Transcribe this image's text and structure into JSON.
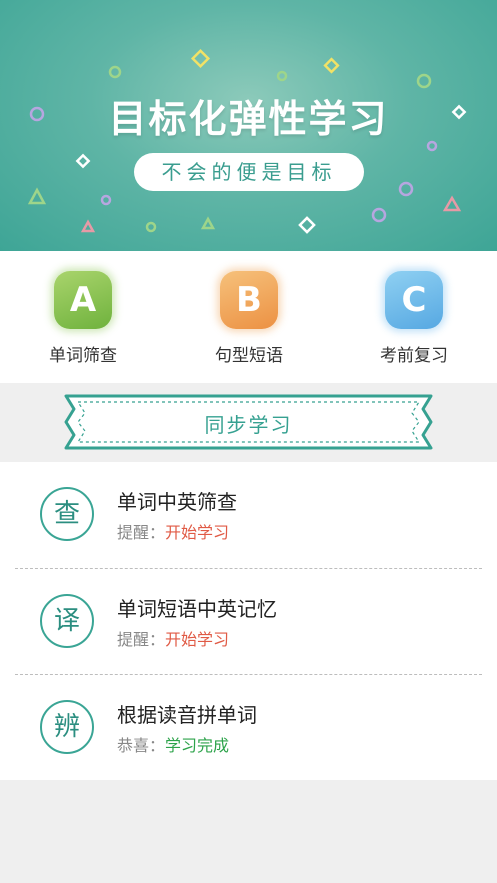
{
  "banner": {
    "title": "目标化弹性学习",
    "pill": "不会的便是目标"
  },
  "categories": [
    {
      "letter": "A",
      "label": "单词筛查",
      "color": "#7dbb48"
    },
    {
      "letter": "B",
      "label": "句型短语",
      "color": "#f0a055"
    },
    {
      "letter": "C",
      "label": "考前复习",
      "color": "#62b1e6"
    }
  ],
  "section": {
    "title": "同步学习"
  },
  "items": [
    {
      "icon_char": "查",
      "title": "单词中英筛查",
      "prefix": "提醒：",
      "status": "开始学习",
      "status_color": "#e05a45"
    },
    {
      "icon_char": "译",
      "title": "单词短语中英记忆",
      "prefix": "提醒：",
      "status": "开始学习",
      "status_color": "#e05a45"
    },
    {
      "icon_char": "辨",
      "title": "根据读音拼单词",
      "prefix": "恭喜：",
      "status": "学习完成",
      "status_color": "#2ca34a"
    }
  ],
  "colors": {
    "brand_teal": "#3ea596"
  }
}
